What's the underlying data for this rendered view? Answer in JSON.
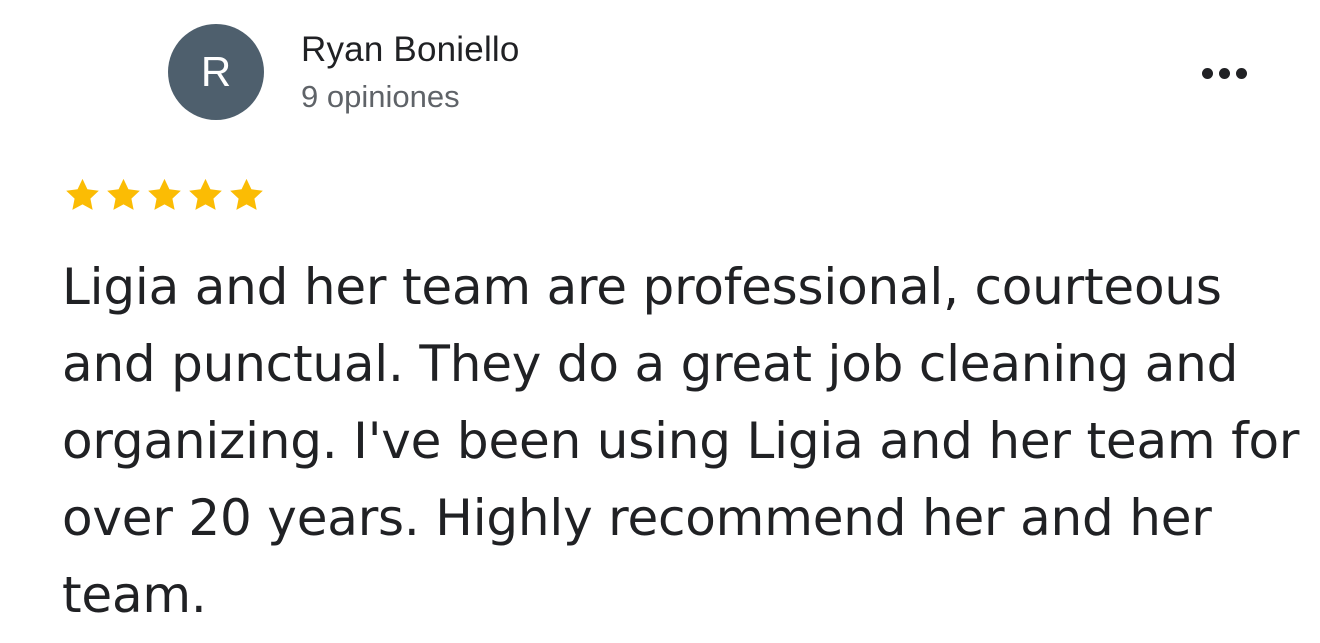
{
  "review": {
    "author": {
      "initial": "R",
      "name": "Ryan Boniello",
      "review_count": "9 opiniones",
      "avatar_color": "#4e5f6d"
    },
    "more_options_icon": "more-horizontal-icon",
    "rating": {
      "value": 5,
      "max": 5,
      "star_color": "#fbbc04"
    },
    "text": "Ligia and her team are professional, courteous and punctual. They do a great job cleaning and organizing. I've been using Ligia and her team for over 20 years. Highly recommend her and her team."
  }
}
